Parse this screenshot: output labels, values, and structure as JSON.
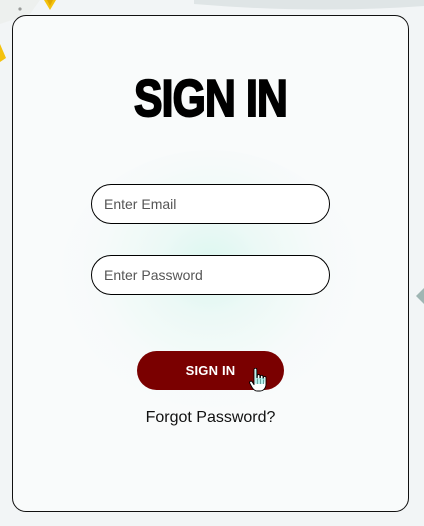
{
  "form": {
    "title": "SIGN IN",
    "email_placeholder": "Enter Email",
    "password_placeholder": "Enter Password",
    "submit_label": "SIGN IN",
    "forgot_label": "Forgot Password?"
  },
  "colors": {
    "button_bg": "#7a0000",
    "button_text": "#ffffff",
    "card_border": "#111111",
    "page_bg": "#f2f5f6",
    "glow": "#78e6c8"
  },
  "icons": {
    "cursor": "hand-pointer-icon"
  }
}
